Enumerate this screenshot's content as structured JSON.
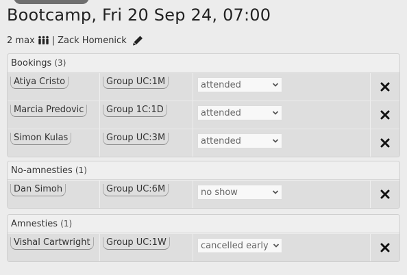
{
  "header": {
    "title": "Bootcamp, Fri 20 Sep 24, 07:00",
    "capacity": "2 max",
    "separator": "|",
    "instructor": "Zack Homenick"
  },
  "sections": [
    {
      "title": "Bookings",
      "count": "(3)",
      "rows": [
        {
          "name": "Atiya Cristo",
          "group": "Group UC:1M",
          "status": "attended"
        },
        {
          "name": "Marcia Predovic",
          "group": "Group 1C:1D",
          "status": "attended"
        },
        {
          "name": "Simon Kulas",
          "group": "Group UC:3M",
          "status": "attended"
        }
      ]
    },
    {
      "title": "No-amnesties",
      "count": "(1)",
      "rows": [
        {
          "name": "Dan Simoh",
          "group": "Group UC:6M",
          "status": "no show"
        }
      ]
    },
    {
      "title": "Amnesties",
      "count": "(1)",
      "rows": [
        {
          "name": "Vishal Cartwright",
          "group": "Group UC:1W",
          "status": "cancelled early"
        }
      ]
    }
  ],
  "icons": {
    "capacity": "people-icon",
    "edit": "pencil-icon",
    "delete": "close-icon",
    "select": "chevron-down-icon"
  }
}
